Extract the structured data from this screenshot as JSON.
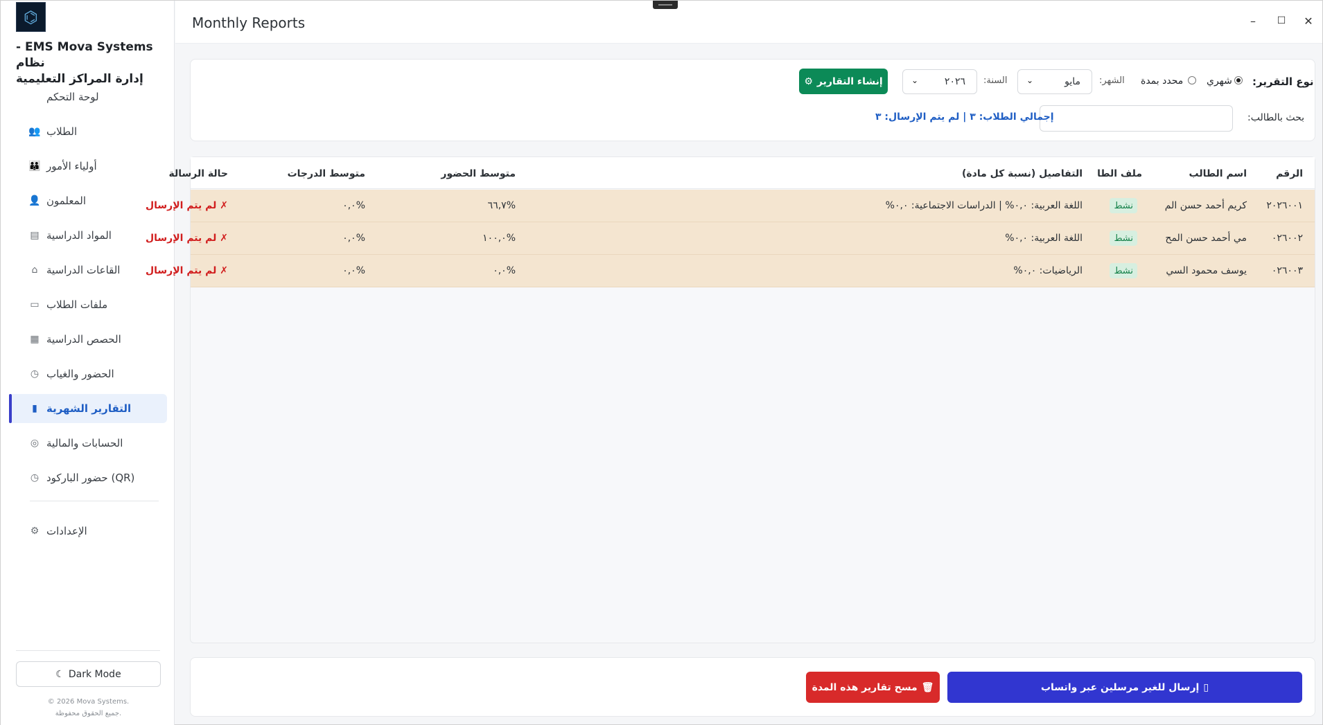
{
  "window": {
    "title": "Monthly Reports",
    "minimize": "–",
    "maximize": "☐",
    "close": "✕"
  },
  "sidebar": {
    "title_line1": "EMS Mova Systems -  نظام",
    "title_line2": "إدارة المراكز التعليمية",
    "items": [
      {
        "label": "لوحة التحكم",
        "icon": "dashboard-icon",
        "glyph": ""
      },
      {
        "label": "الطلاب",
        "icon": "students-icon",
        "glyph": "👥"
      },
      {
        "label": "أولياء الأمور",
        "icon": "parents-icon",
        "glyph": "👪"
      },
      {
        "label": "المعلمون",
        "icon": "teachers-icon",
        "glyph": "👤"
      },
      {
        "label": "المواد الدراسية",
        "icon": "subjects-icon",
        "glyph": "▤"
      },
      {
        "label": "القاعات الدراسية",
        "icon": "classrooms-icon",
        "glyph": "⌂"
      },
      {
        "label": "ملفات الطلاب",
        "icon": "folder-icon",
        "glyph": "▭"
      },
      {
        "label": "الحصص الدراسية",
        "icon": "sessions-icon",
        "glyph": "▦"
      },
      {
        "label": "الحضور والغياب",
        "icon": "clock-icon",
        "glyph": "◷"
      },
      {
        "label": "التقارير الشهرية",
        "icon": "reports-icon",
        "glyph": "▮"
      },
      {
        "label": "الحسابات والمالية",
        "icon": "money-icon",
        "glyph": "◎"
      },
      {
        "label": "حضور الباركود (QR)",
        "icon": "qr-icon",
        "glyph": "◷"
      }
    ],
    "settings_label": "الإعدادات",
    "settings_glyph": "⚙",
    "dark_mode_label": "Dark Mode",
    "copyright": "© 2026 Mova Systems.",
    "rights": "جميع الحقوق محفوظة."
  },
  "filters": {
    "report_type_label": "نوع التقرير:",
    "monthly_label": "شهري",
    "period_label": "محدد بمدة",
    "month_label": "الشهر:",
    "month_value": "مايو",
    "year_label": "السنة:",
    "year_value": "٢٠٢٦",
    "generate_label": "إنشاء التقارير",
    "search_label": "بحث بالطالب:",
    "search_value": "",
    "summary": "إجمالي الطلاب: ٣ | لم يتم الإرسال: ٣"
  },
  "table": {
    "headers": {
      "id": "الرقم",
      "name": "اسم الطالب",
      "file": "ملف الطا",
      "details": "التفاصيل (نسبة كل مادة)",
      "attendance": "متوسط الحضور",
      "grades": "متوسط الدرجات",
      "status": "حالة الرسالة"
    },
    "rows": [
      {
        "id": "٢٠٢٦٠٠١",
        "name": "كريم أحمد حسن الم",
        "file": "نشط",
        "details": "اللغة العربية: ٠,٠% | الدراسات الاجتماعية: ٠,٠%",
        "attendance": "%٦٦,٧",
        "grades": "%٠,٠",
        "status": "✗ لم يتم الإرسال"
      },
      {
        "id": "٠٢٦٠٠٢",
        "name": "مي أحمد حسن المح",
        "file": "نشط",
        "details": "اللغة العربية: ٠,٠%",
        "attendance": "%١٠٠,٠",
        "grades": "%٠,٠",
        "status": "✗ لم يتم الإرسال"
      },
      {
        "id": "٠٢٦٠٠٣",
        "name": "يوسف محمود السي",
        "file": "نشط",
        "details": "الرياضيات: ٠,٠%",
        "attendance": "%٠,٠",
        "grades": "%٠,٠",
        "status": "✗ لم يتم الإرسال"
      }
    ]
  },
  "actions": {
    "send_whatsapp": "إرسال للغير مرسلين عبر واتساب",
    "delete_reports": "مسح تقارير هذه المدة"
  },
  "colors": {
    "accent": "#3136d0",
    "generate": "#0c8a57",
    "danger": "#d82a2a",
    "row_bg": "#f4e5d0"
  }
}
